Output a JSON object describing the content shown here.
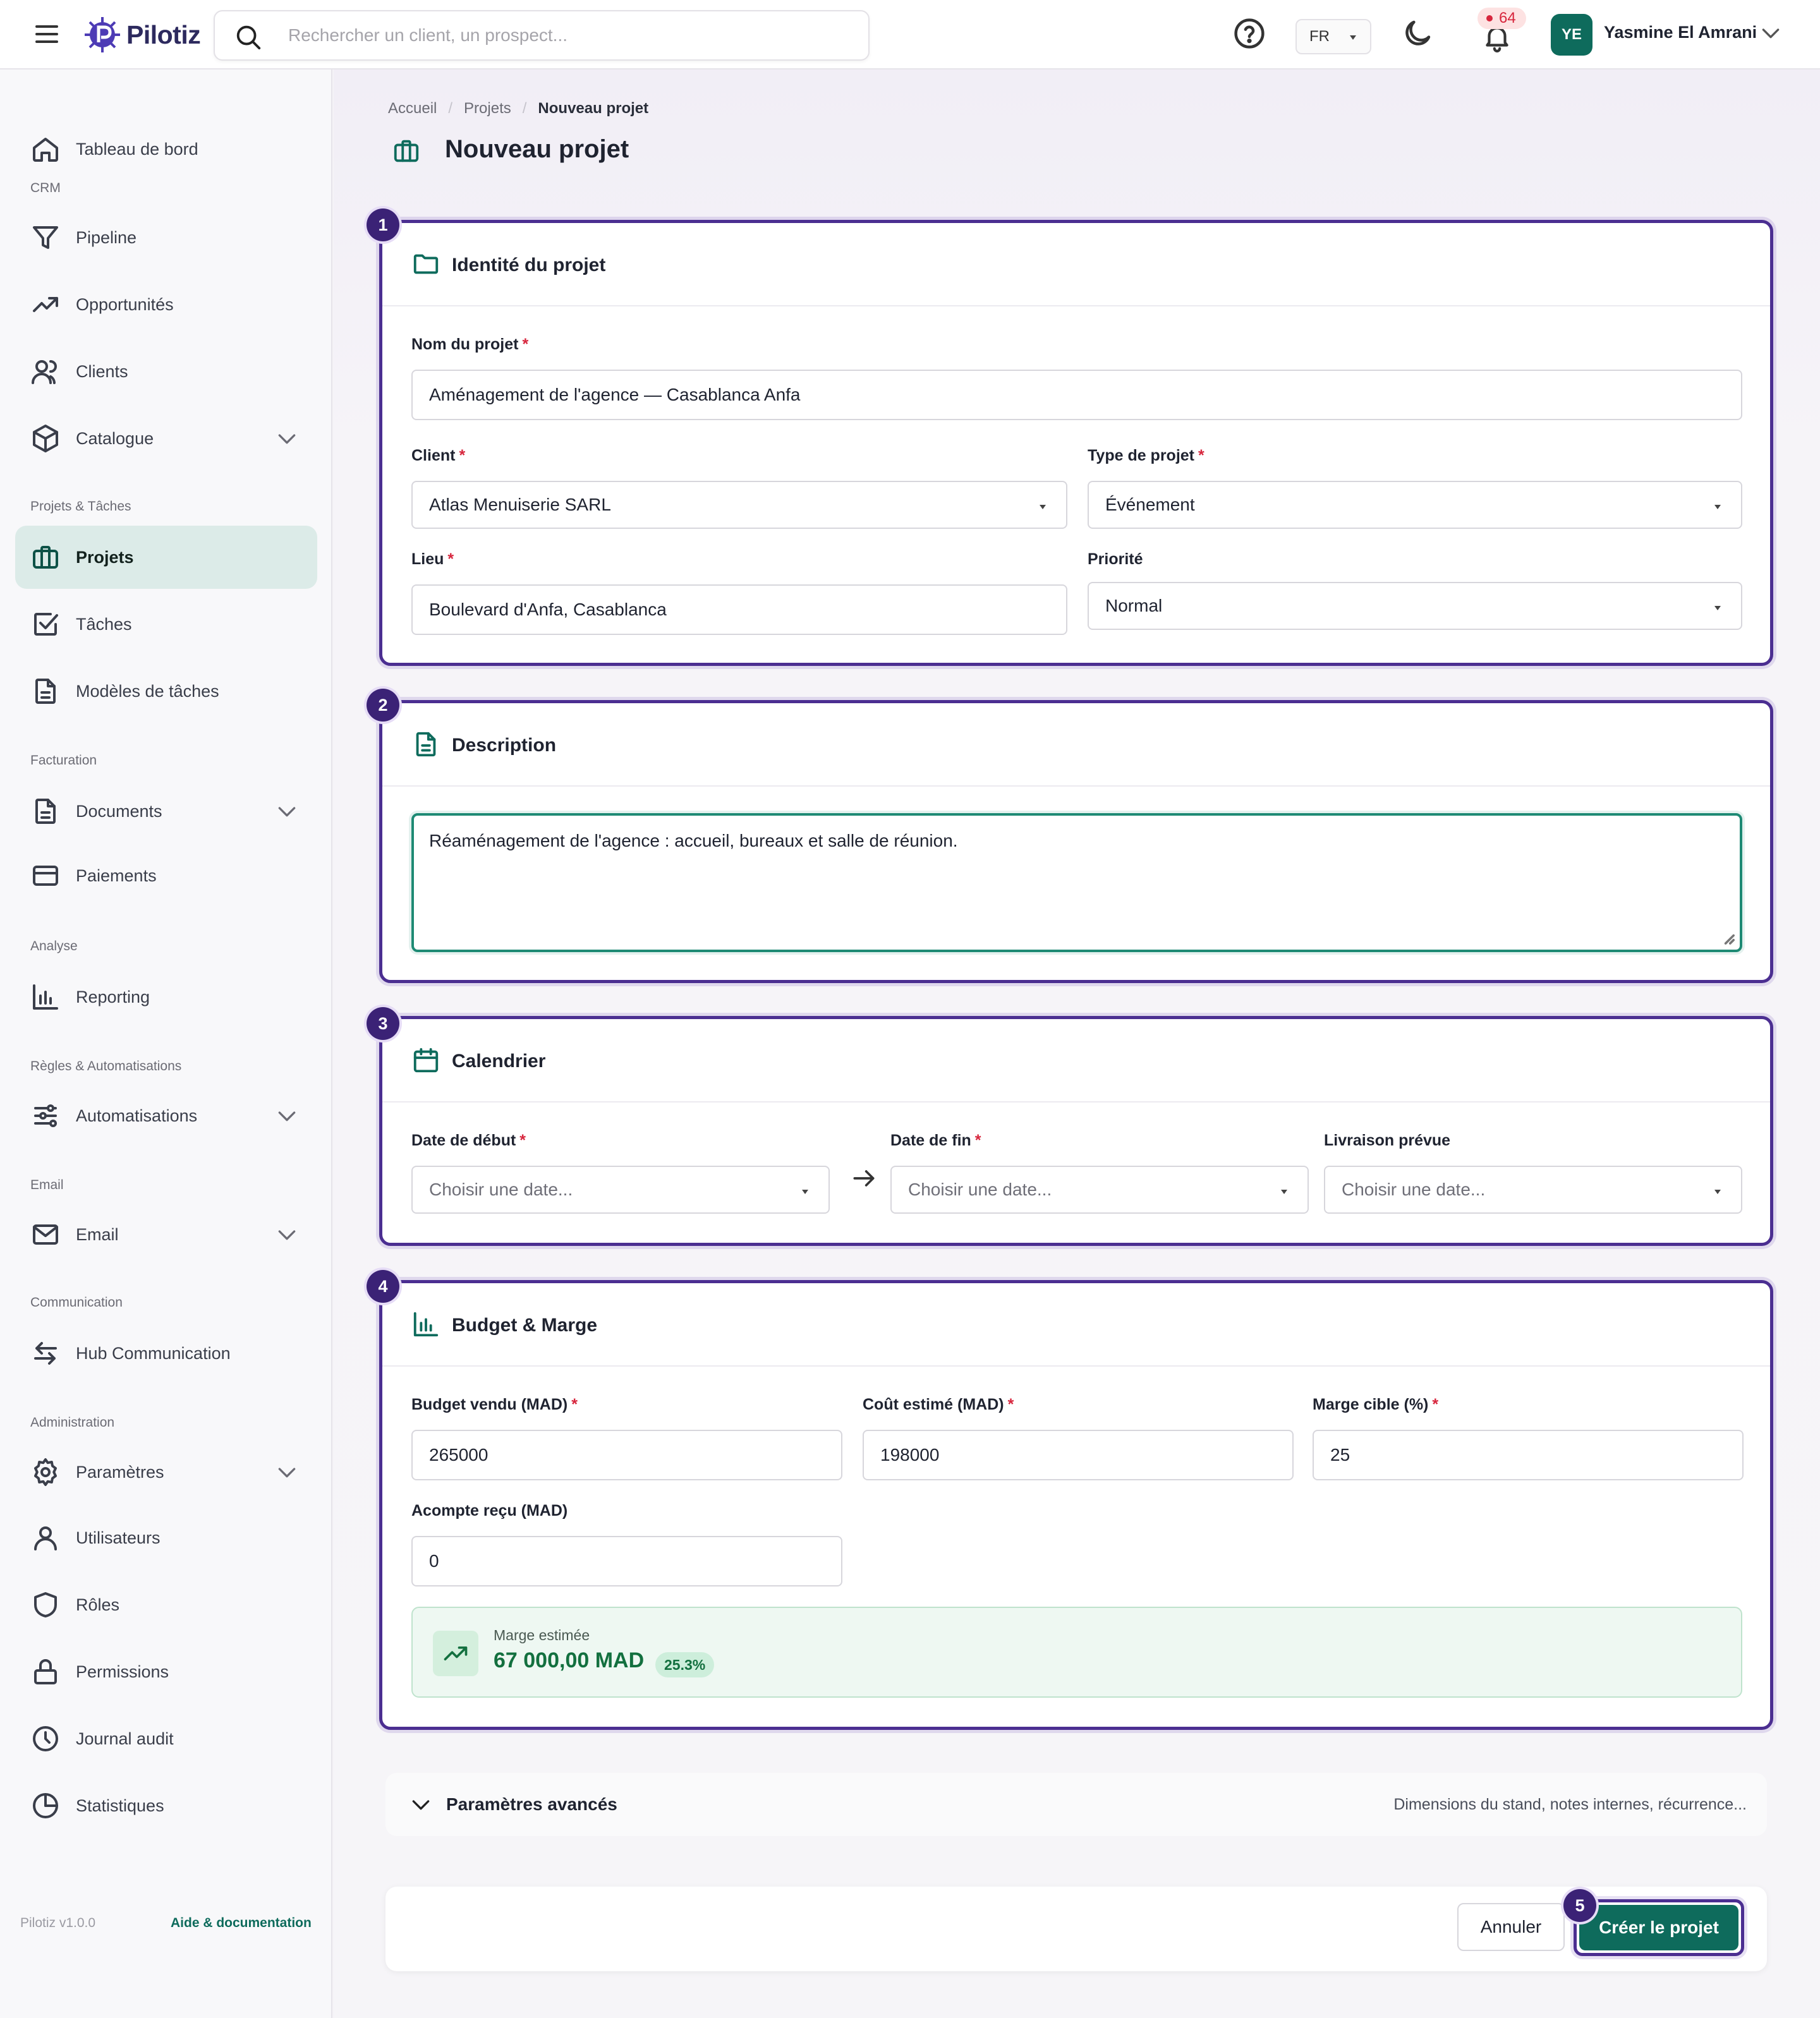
{
  "app": {
    "name": "Pilotiz",
    "version": "Pilotiz v1.0.0",
    "help_link": "Aide & documentation"
  },
  "topbar": {
    "search_placeholder": "Rechercher un client, un prospect...",
    "language": "FR",
    "notifications_count": "64",
    "user_initials": "YE",
    "user_name": "Yasmine El Amrani"
  },
  "sidebar": {
    "sections": {
      "crm": "CRM",
      "projects": "Projets & Tâches",
      "billing": "Facturation",
      "analysis": "Analyse",
      "rules": "Règles & Automatisations",
      "email": "Email",
      "communication": "Communication",
      "admin": "Administration"
    },
    "items": {
      "dashboard": "Tableau de bord",
      "pipeline": "Pipeline",
      "opportunities": "Opportunités",
      "clients": "Clients",
      "catalog": "Catalogue",
      "projects": "Projets",
      "tasks": "Tâches",
      "task_templates": "Modèles de tâches",
      "documents": "Documents",
      "payments": "Paiements",
      "reporting": "Reporting",
      "automations": "Automatisations",
      "email": "Email",
      "hub": "Hub Communication",
      "settings": "Paramètres",
      "users": "Utilisateurs",
      "roles": "Rôles",
      "permissions": "Permissions",
      "audit": "Journal audit",
      "stats": "Statistiques"
    },
    "active": "projects"
  },
  "breadcrumb": {
    "home": "Accueil",
    "projects": "Projets",
    "current": "Nouveau projet"
  },
  "page": {
    "title": "Nouveau projet"
  },
  "sections": {
    "identity": {
      "step": "1",
      "title": "Identité du projet",
      "name_label": "Nom du projet",
      "name_value": "Aménagement de l'agence — Casablanca Anfa",
      "client_label": "Client",
      "client_value": "Atlas Menuiserie SARL",
      "type_label": "Type de projet",
      "type_value": "Événement",
      "location_label": "Lieu",
      "location_value": "Boulevard d'Anfa, Casablanca",
      "priority_label": "Priorité",
      "priority_value": "Normal"
    },
    "description": {
      "step": "2",
      "title": "Description",
      "value": "Réaménagement de l'agence : accueil, bureaux et salle de réunion."
    },
    "calendar": {
      "step": "3",
      "title": "Calendrier",
      "start_label": "Date de début",
      "end_label": "Date de fin",
      "delivery_label": "Livraison prévue",
      "date_placeholder": "Choisir une date..."
    },
    "budget": {
      "step": "4",
      "title": "Budget & Marge",
      "sold_label": "Budget vendu (MAD)",
      "sold_value": "265000",
      "cost_label": "Coût estimé (MAD)",
      "cost_value": "198000",
      "target_label": "Marge cible (%)",
      "target_value": "25",
      "deposit_label": "Acompte reçu (MAD)",
      "deposit_value": "0",
      "margin_label": "Marge estimée",
      "margin_value": "67 000,00 MAD",
      "margin_pct": "25.3%"
    }
  },
  "advanced": {
    "title": "Paramètres avancés",
    "hint": "Dimensions du stand, notes internes, récurrence..."
  },
  "actions": {
    "cancel": "Annuler",
    "create": "Créer le projet",
    "create_step": "5"
  },
  "colors": {
    "brand": "#0e6b5c",
    "highlight": "#4b2e91",
    "required": "#d7263d",
    "success": "#13703f"
  }
}
